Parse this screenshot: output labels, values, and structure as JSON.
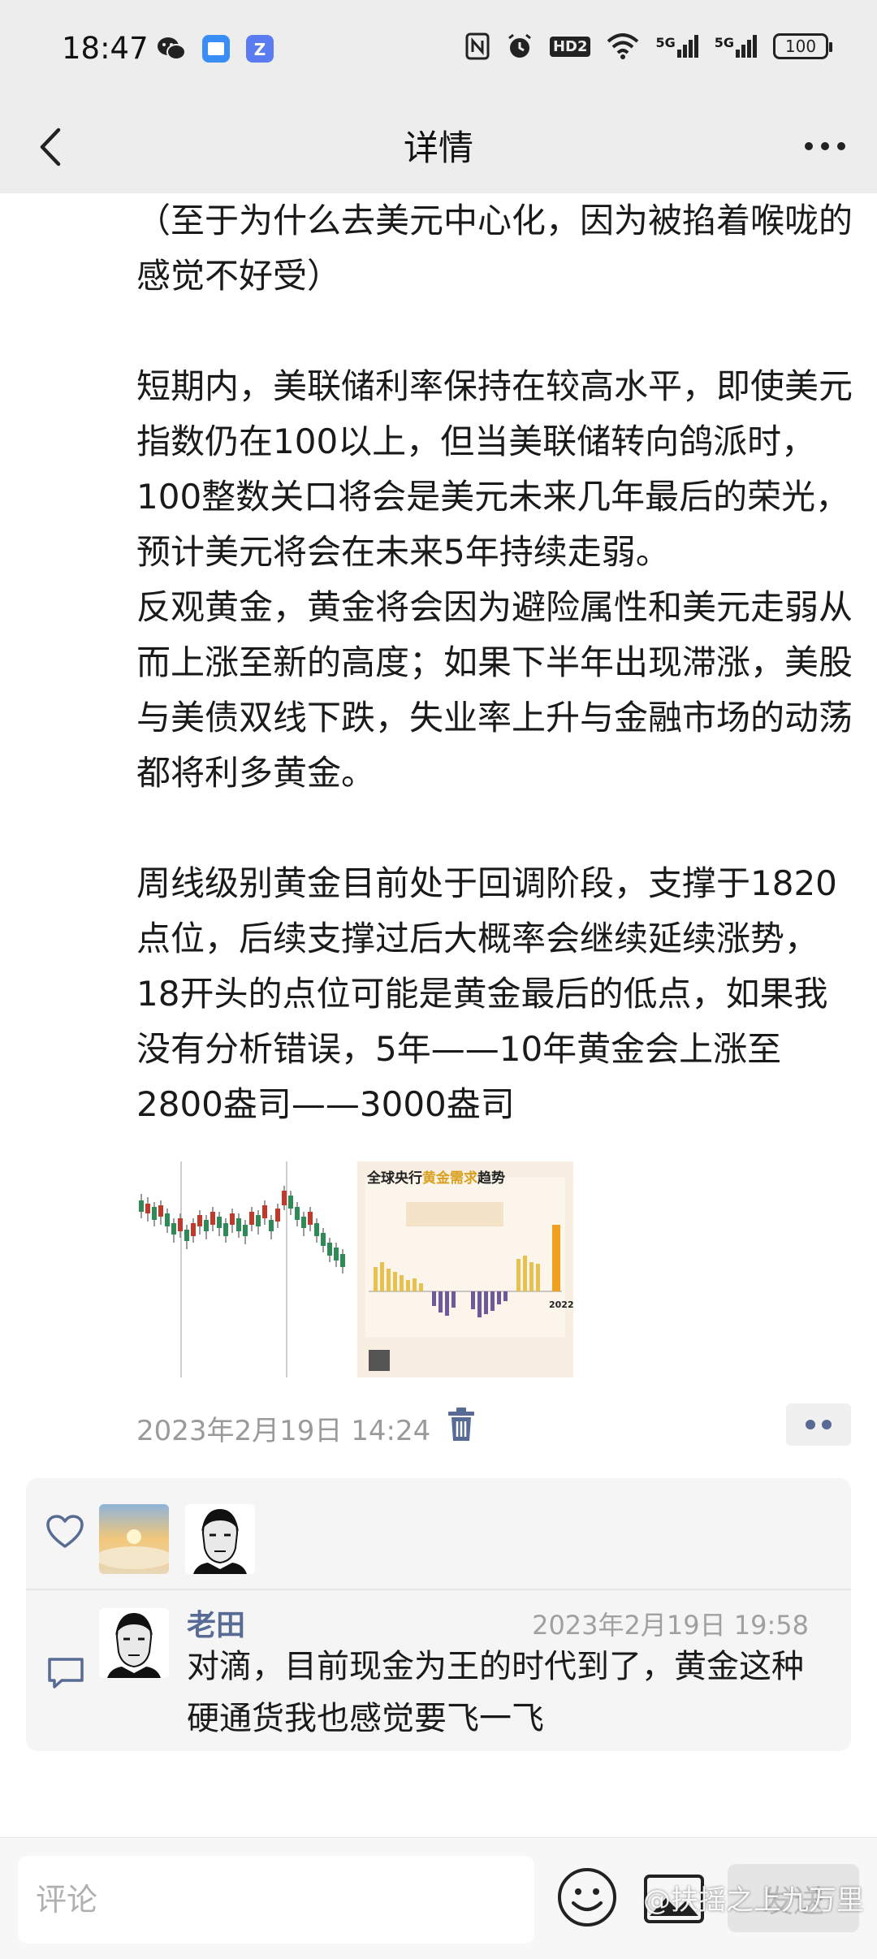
{
  "status_bar": {
    "time": "18:47",
    "network_hd": "HD2",
    "signal_1": "5G",
    "signal_2": "5G",
    "battery": "100",
    "app_icons": [
      "wechat-icon",
      "notes-app-icon",
      "zalo-app-icon"
    ]
  },
  "nav": {
    "title": "详情"
  },
  "article": {
    "paragraphs": [
      "（至于为什么去美元中心化，因为被掐着喉咙的感觉不好受）",
      "",
      "短期内，美联储利率保持在较高水平，即使美元指数仍在100以上，但当美联储转向鸽派时，100整数关口将会是美元未来几年最后的荣光，预计美元将会在未来5年持续走弱。",
      "反观黄金，黄金将会因为避险属性和美元走弱从而上涨至新的高度；如果下半年出现滞涨，美股与美债双线下跌，失业率上升与金融市场的动荡都将利多黄金。",
      "",
      "周线级别黄金目前处于回调阶段，支撑于1820点位，后续支撑过后大概率会继续延续涨势，18开头的点位可能是黄金最后的低点，如果我没有分析错误，5年——10年黄金会上涨至2800盎司——3000盎司"
    ]
  },
  "images": {
    "thumb2_title": "全球央行黄金需求趋势",
    "thumb2_highlight": "黄金需求",
    "thumb2_label": "2022"
  },
  "meta": {
    "post_time": "2023年2月19日 14:24"
  },
  "comments": [
    {
      "name": "老田",
      "time": "2023年2月19日 19:58",
      "text": "对滴，目前现金为王的时代到了，黄金这种硬通货我也感觉要飞一飞"
    }
  ],
  "bottom_bar": {
    "input_placeholder": "评论",
    "send_label": "发送",
    "watermark": "@扶摇之上九万里"
  },
  "colors": {
    "link_blue": "#576b95",
    "bar_bg": "#ededed"
  }
}
